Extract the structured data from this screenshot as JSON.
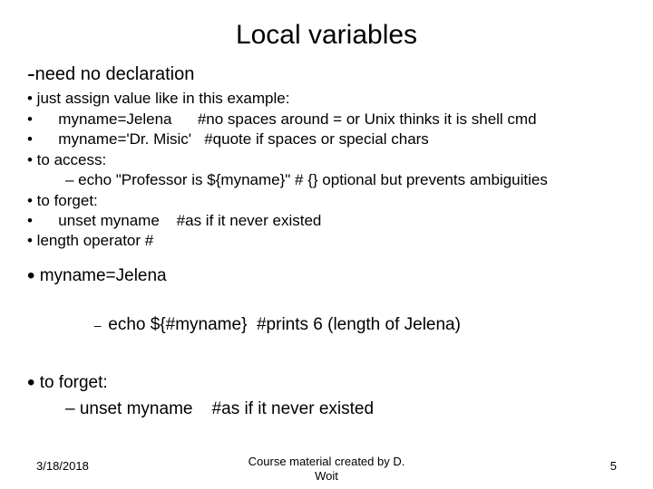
{
  "title": "Local variables",
  "lead": "need no declaration",
  "bullets": {
    "b1": "• just assign value like in this example:",
    "b2": "•      myname=Jelena      #no spaces around = or Unix thinks it is shell cmd",
    "b3": "•      myname='Dr. Misic'   #quote if spaces or special chars",
    "b4": "• to access:",
    "b4a": "– echo \"Professor is ${myname}\"  # {} optional but prevents ambiguities",
    "b5": "• to forget:",
    "b6": "•      unset myname    #as if it never existed",
    "b7": "• length operator #"
  },
  "section2": {
    "s1": "myname=Jelena",
    "s1a": "echo ${#myname}  #prints 6 (length of Jelena)",
    "s2": "to forget:",
    "s2a": "– unset myname    #as if it never existed"
  },
  "footer": {
    "date": "3/18/2018",
    "credit_line1": "Course material created by D.",
    "credit_line2": "Woit",
    "page": "5"
  }
}
